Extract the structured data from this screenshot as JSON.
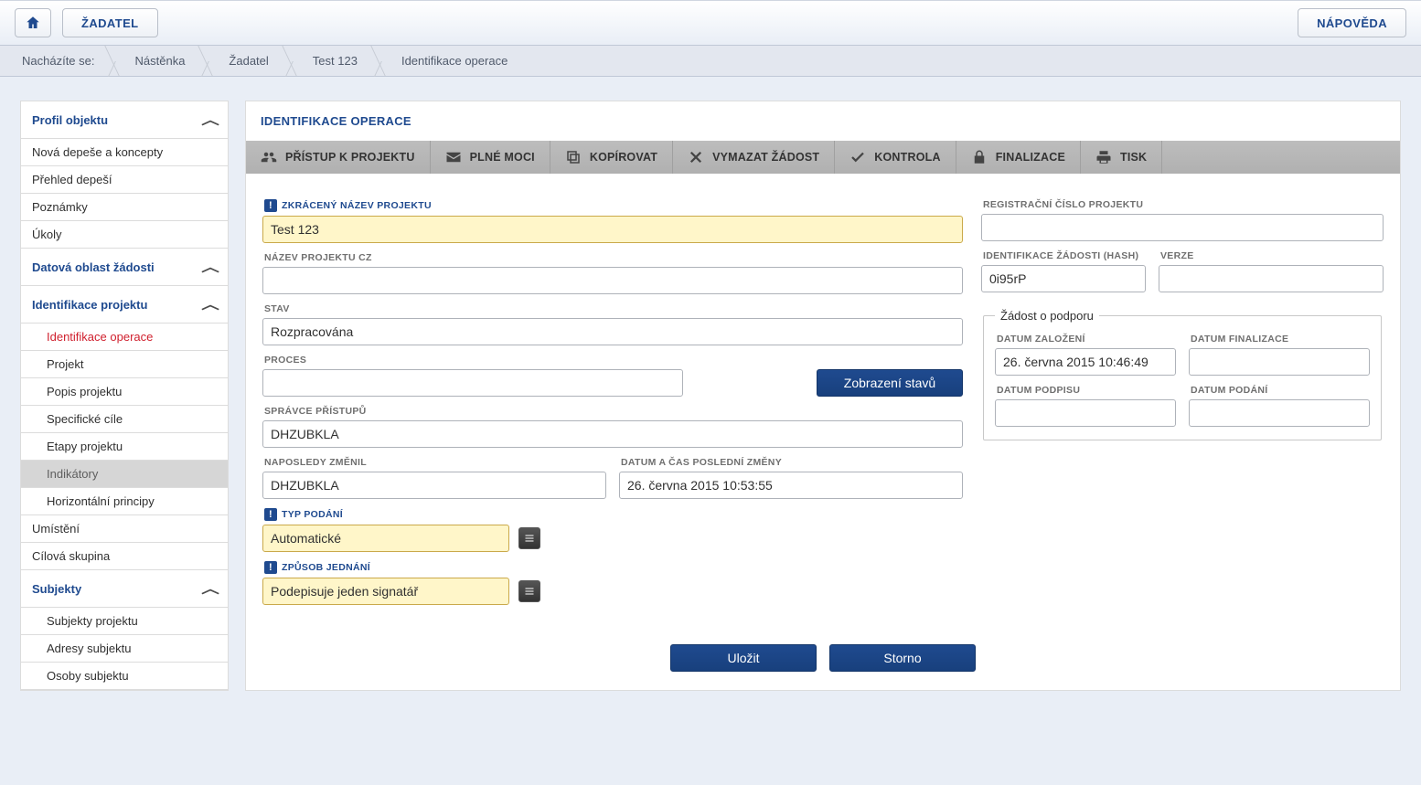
{
  "topbar": {
    "applicant_label": "ŽADATEL",
    "help_label": "NÁPOVĚDA"
  },
  "breadcrumb": {
    "prefix": "Nacházíte se:",
    "items": [
      "Nástěnka",
      "Žadatel",
      "Test 123"
    ],
    "current": "Identifikace operace"
  },
  "sidebar": {
    "profile_header": "Profil objektu",
    "profile_items": [
      "Nová depeše a koncepty",
      "Přehled depeší",
      "Poznámky",
      "Úkoly"
    ],
    "data_header": "Datová oblast žádosti",
    "ident_header": "Identifikace projektu",
    "ident_items": [
      {
        "label": "Identifikace operace",
        "active": true
      },
      {
        "label": "Projekt"
      },
      {
        "label": "Popis projektu"
      },
      {
        "label": "Specifické cíle"
      },
      {
        "label": "Etapy projektu"
      },
      {
        "label": "Indikátory",
        "highlight": true
      },
      {
        "label": "Horizontální principy"
      }
    ],
    "extra_items": [
      "Umístění",
      "Cílová skupina"
    ],
    "subjects_header": "Subjekty",
    "subjects_items": [
      "Subjekty projektu",
      "Adresy subjektu",
      "Osoby subjektu"
    ]
  },
  "main": {
    "title": "IDENTIFIKACE OPERACE",
    "actions": [
      {
        "id": "access",
        "label": "PŘÍSTUP K PROJEKTU",
        "icon": "people"
      },
      {
        "id": "poa",
        "label": "PLNÉ MOCI",
        "icon": "mail"
      },
      {
        "id": "copy",
        "label": "KOPÍROVAT",
        "icon": "copy"
      },
      {
        "id": "delete",
        "label": "VYMAZAT ŽÁDOST",
        "icon": "x"
      },
      {
        "id": "check",
        "label": "KONTROLA",
        "icon": "check"
      },
      {
        "id": "finalize",
        "label": "FINALIZACE",
        "icon": "lock"
      },
      {
        "id": "print",
        "label": "TISK",
        "icon": "print"
      }
    ],
    "labels": {
      "short_name": "ZKRÁCENÝ NÁZEV PROJEKTU",
      "name_cz": "NÁZEV PROJEKTU CZ",
      "state": "STAV",
      "process": "PROCES",
      "show_states": "Zobrazení stavů",
      "access_admin": "SPRÁVCE PŘÍSTUPŮ",
      "last_changed_by": "NAPOSLEDY ZMĚNIL",
      "last_change_dt": "DATUM A ČAS POSLEDNÍ ZMĚNY",
      "submission_type": "TYP PODÁNÍ",
      "action_mode": "ZPŮSOB JEDNÁNÍ",
      "reg_number": "REGISTRAČNÍ ČÍSLO PROJEKTU",
      "hash": "IDENTIFIKACE ŽÁDOSTI (HASH)",
      "version": "VERZE",
      "request_box": "Žádost o podporu",
      "created_dt": "DATUM ZALOŽENÍ",
      "finalize_dt": "DATUM FINALIZACE",
      "sign_dt": "DATUM PODPISU",
      "submit_dt": "DATUM PODÁNÍ",
      "save": "Uložit",
      "cancel": "Storno"
    },
    "values": {
      "short_name": "Test 123",
      "name_cz": "",
      "state": "Rozpracována",
      "process": "",
      "access_admin": "DHZUBKLA",
      "last_changed_by": "DHZUBKLA",
      "last_change_dt": "26. června 2015 10:53:55",
      "submission_type": "Automatické",
      "action_mode": "Podepisuje jeden signatář",
      "reg_number": "",
      "hash": "0i95rP",
      "version": "",
      "created_dt": "26. června 2015 10:46:49",
      "finalize_dt": "",
      "sign_dt": "",
      "submit_dt": ""
    }
  }
}
